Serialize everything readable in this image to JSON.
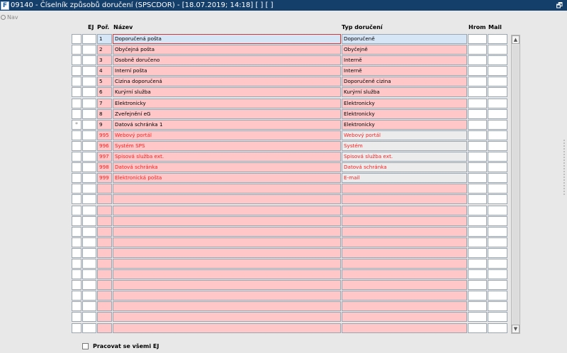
{
  "window": {
    "title": "09140 - Číselník způsobů doručení (SPSCDOR) - [18.07.2019; 14:18]  [ ]  [ ]",
    "app_icon": "F"
  },
  "nav": {
    "label": "Nav"
  },
  "columns": {
    "ej": "EJ",
    "por": "Poř.",
    "nazev": "Název",
    "typ": "Typ doručení",
    "hrom": "Hrom",
    "mail": "Mail"
  },
  "rows": [
    {
      "por": "1",
      "nazev": "Doporučená pošta",
      "typ": "Doporučeně"
    },
    {
      "por": "2",
      "nazev": "Obyčejná pošta",
      "typ": "Obyčejně"
    },
    {
      "por": "3",
      "nazev": "Osobně doručeno",
      "typ": "Interně"
    },
    {
      "por": "4",
      "nazev": "Interní pošta",
      "typ": "Interně"
    },
    {
      "por": "5",
      "nazev": "Cizina doporučená",
      "typ": "Doporučeně cizina"
    },
    {
      "por": "6",
      "nazev": "Kurýrní služba",
      "typ": "Kurýrní služba"
    },
    {
      "por": "7",
      "nazev": "Elektronicky",
      "typ": "Elektronicky"
    },
    {
      "por": "8",
      "nazev": "Zveřejnění eG",
      "typ": "Elektronicky"
    },
    {
      "por": "9",
      "nazev": "Datová schránka 1",
      "typ": "Elektronicky",
      "marker": "*"
    },
    {
      "por": "995",
      "nazev": "Webový portál",
      "typ": "Webový portál"
    },
    {
      "por": "996",
      "nazev": "Systém SPS",
      "typ": "Systém"
    },
    {
      "por": "997",
      "nazev": "Spisová služba ext.",
      "typ": "Spisová služba ext."
    },
    {
      "por": "998",
      "nazev": "Datová schránka",
      "typ": "Datová schránka"
    },
    {
      "por": "999",
      "nazev": "Elektronická pošta",
      "typ": "E-mail"
    }
  ],
  "empty_rows": 14,
  "footer": {
    "checkbox_label": "Pracovat se všemi EJ"
  },
  "colors": {
    "titlebar": "#153f6b",
    "row_fill": "#ffc7c7",
    "system_text": "#ff1f1f",
    "selected_fill": "#d6e6f7"
  },
  "icons": {
    "app": "app-logo-icon",
    "restore": "window-restore-icon",
    "scroll_up": "arrow-up-icon",
    "scroll_down": "arrow-down-icon"
  }
}
